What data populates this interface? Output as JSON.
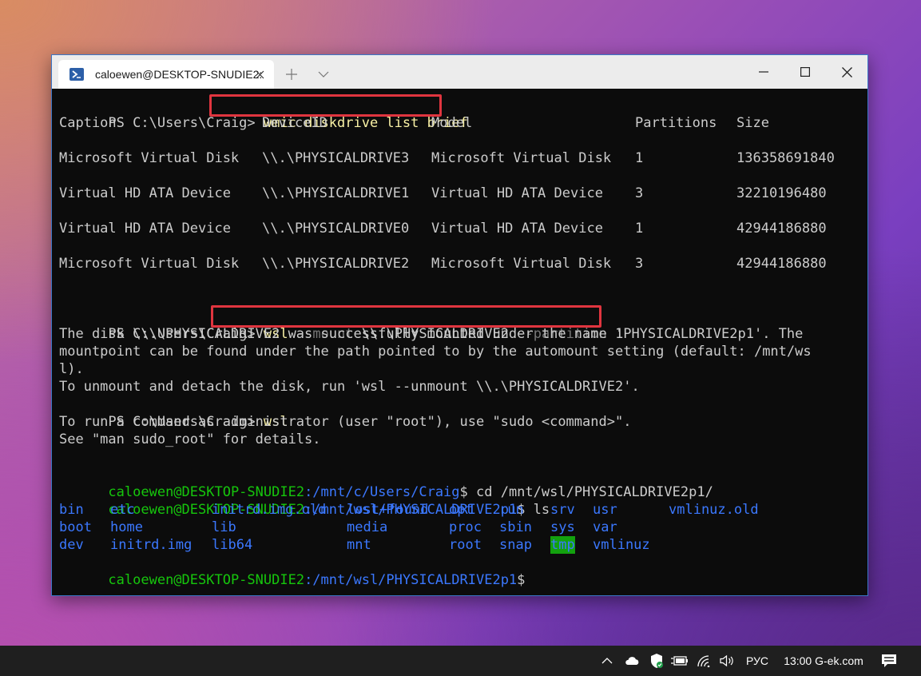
{
  "window": {
    "tab_title": "caloewen@DESKTOP-SNUDIE2:",
    "icons": {
      "tab_icon": "powershell-icon",
      "close_tab": "close-icon",
      "new_tab": "plus-icon",
      "dropdown": "chevron-down-icon",
      "minimize": "minimize-icon",
      "maximize": "maximize-icon",
      "close_window": "close-icon"
    }
  },
  "terminal": {
    "ps_prompt": "PS C:\\Users\\Craig>",
    "cmd1": "wmic diskdrive list brief",
    "table": {
      "headers": [
        "Caption",
        "DeviceID",
        "Model",
        "Partitions",
        "Size"
      ],
      "rows": [
        [
          "Microsoft Virtual Disk",
          "\\\\.\\PHYSICALDRIVE3",
          "Microsoft Virtual Disk",
          "1",
          "136358691840"
        ],
        [
          "Virtual HD ATA Device",
          "\\\\.\\PHYSICALDRIVE1",
          "Virtual HD ATA Device",
          "3",
          "32210196480"
        ],
        [
          "Virtual HD ATA Device",
          "\\\\.\\PHYSICALDRIVE0",
          "Virtual HD ATA Device",
          "1",
          "42944186880"
        ],
        [
          "Microsoft Virtual Disk",
          "\\\\.\\PHYSICALDRIVE2",
          "Microsoft Virtual Disk",
          "3",
          "42944186880"
        ]
      ]
    },
    "cmd2": {
      "exe": "wsl",
      "flag_mount": "--mount",
      "drive": "\\\\.\\PHYSICALDRIVE2",
      "flag_partition": "--partition",
      "num": "1"
    },
    "output_lines": [
      "The disk \\\\.\\PHYSICALDRIVE2 was successfully mounted under the name 'PHYSICALDRIVE2p1'. The",
      "mountpoint can be found under the path pointed to by the automount setting (default: /mnt/ws",
      "l).",
      "To unmount and detach the disk, run 'wsl --unmount \\\\.\\PHYSICALDRIVE2'."
    ],
    "cmd3": "wsl",
    "sudo_lines": [
      "To run a command as administrator (user \"root\"), use \"sudo <command>\".",
      "See \"man sudo_root\" for details."
    ],
    "bash_user": "caloewen@DESKTOP-SNUDIE2",
    "bash_path1": ":/mnt/c/Users/Craig",
    "bash_cmd1": "$ cd /mnt/wsl/PHYSICALDRIVE2p1/",
    "bash_path2": ":/mnt/wsl/PHYSICALDRIVE2p1",
    "bash_cmd2": "$ ls",
    "ls_rows": [
      [
        "bin",
        "etc",
        "initrd.img.old",
        "lost+found",
        "opt",
        "run",
        "srv",
        "usr",
        "vmlinuz.old"
      ],
      [
        "boot",
        "home",
        "lib",
        "media",
        "proc",
        "sbin",
        "sys",
        "var",
        ""
      ],
      [
        "dev",
        "initrd.img",
        "lib64",
        "mnt",
        "root",
        "snap",
        "tmp",
        "vmlinuz",
        ""
      ]
    ],
    "bash_prompt_end": "$"
  },
  "taskbar": {
    "icons": [
      "chevron-up-icon",
      "cloud-icon",
      "shield-icon",
      "battery-icon",
      "wifi-icon",
      "speaker-icon",
      "notification-icon"
    ],
    "lang": "РУС",
    "clock": "13:00 G-ek.com"
  }
}
